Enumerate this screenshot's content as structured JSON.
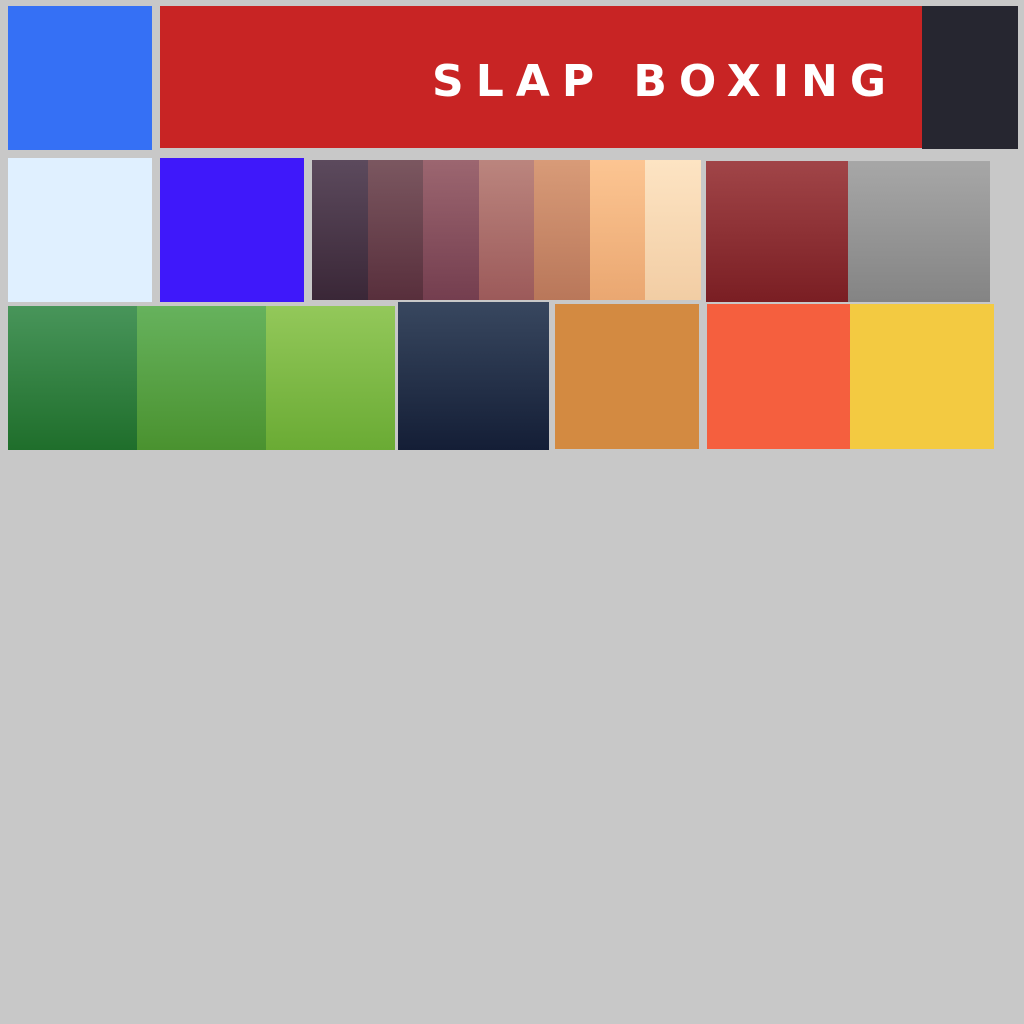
{
  "banner": {
    "title": "SLAP BOXING",
    "color": "#c82424"
  },
  "colors": {
    "row1_left": "#3570f5",
    "row1_right": "#262630",
    "light_blue": "#e0f0ff",
    "violet": "#3f18fa",
    "skin_tones": [
      [
        "#5c4a5d",
        "#3a2737"
      ],
      [
        "#7b5760",
        "#582f3c"
      ],
      [
        "#9c6670",
        "#743e4f"
      ],
      [
        "#bb857e",
        "#9c5a5a"
      ],
      [
        "#d89b78",
        "#b9775a"
      ],
      [
        "#fcc592",
        "#eaa771"
      ],
      [
        "#fde4c3",
        "#f2cda4"
      ]
    ],
    "crimson_gradient": [
      "#a14548",
      "#7a1e23"
    ],
    "gray_gradient": [
      "#a7a7a7",
      "#848484"
    ],
    "greens": [
      [
        "#48955a",
        "#1f6e2b"
      ],
      [
        "#66b25d",
        "#4a922f"
      ],
      [
        "#93c85a",
        "#6aab34"
      ]
    ],
    "navy_gradient": [
      "#38475f",
      "#141e36"
    ],
    "orange": "#d38a41",
    "coral": "#f55f3e",
    "yellow": "#f3ca41"
  }
}
